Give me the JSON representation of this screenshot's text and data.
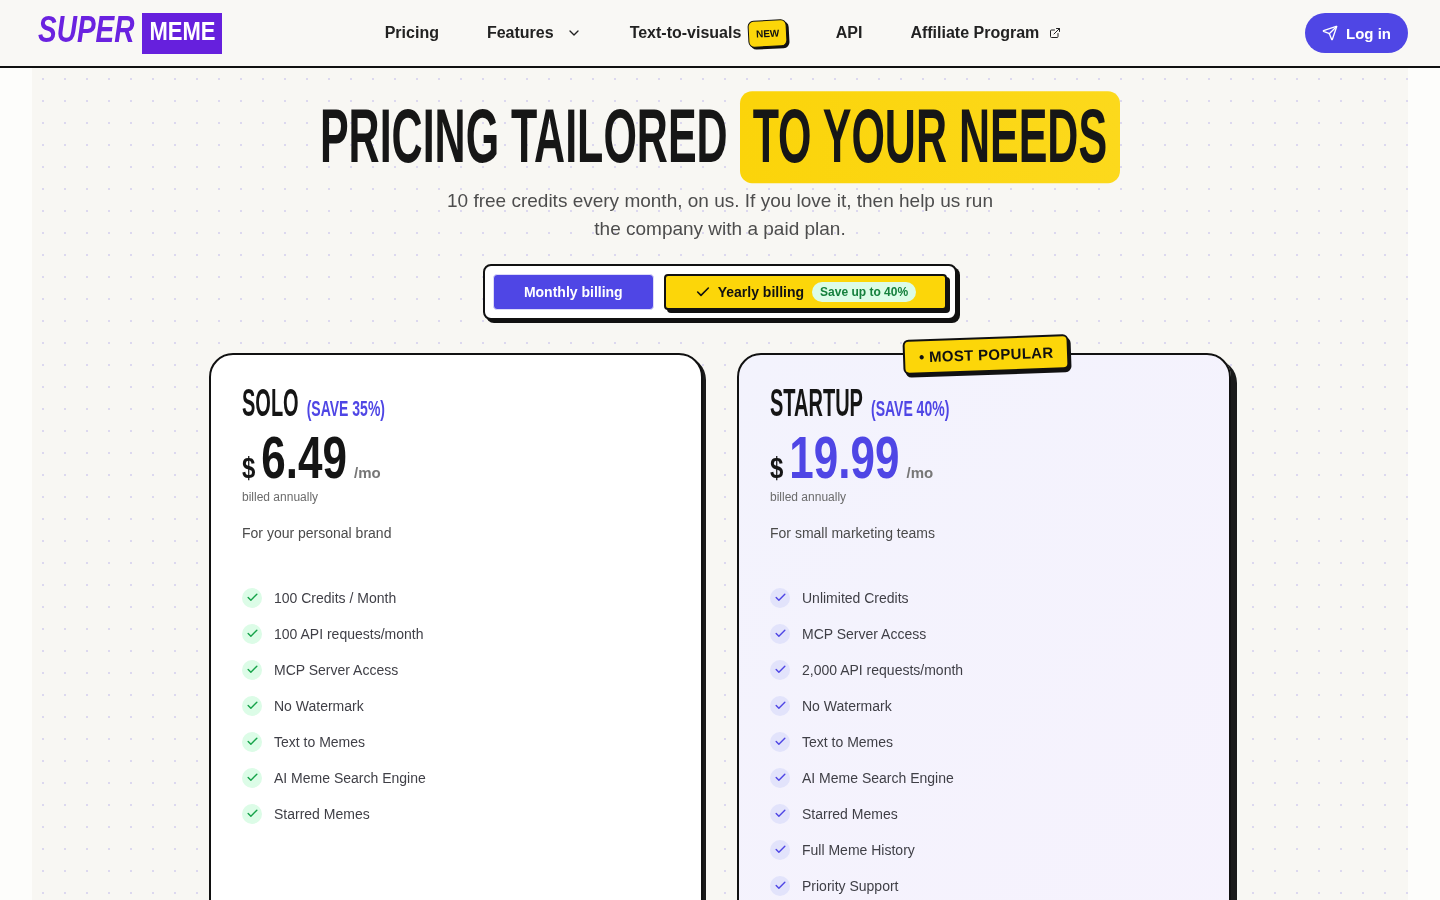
{
  "header": {
    "logo": {
      "text": "SUPER",
      "highlight": "MEME"
    },
    "nav": [
      {
        "label": "Pricing",
        "kind": "link"
      },
      {
        "label": "Features",
        "kind": "dropdown"
      },
      {
        "label": "Text-to-visuals",
        "kind": "link",
        "badge": "NEW"
      },
      {
        "label": "API",
        "kind": "link"
      },
      {
        "label": "Affiliate Program",
        "kind": "external"
      }
    ],
    "login_button": "Log in"
  },
  "hero": {
    "title": "PRICING TAILORED",
    "title_highlight": "TO YOUR NEEDS",
    "subtitle": "10 free credits every month, on us. If you love it, then help us run the company with a paid plan."
  },
  "billing_options": [
    {
      "label": "Monthly billing",
      "selected": false
    },
    {
      "label": "Yearly billing",
      "selected": true,
      "tag": "Save up to 40%"
    }
  ],
  "plans": [
    {
      "name": "SOLO",
      "saving": "(SAVE 35%)",
      "featured": false,
      "currency": "$",
      "price": "6.49",
      "period": "/mo",
      "billing_note": "billed annually",
      "description": "For your personal brand",
      "features": [
        "100 Credits / Month",
        "100 API requests/month",
        "MCP Server Access",
        "No Watermark",
        "Text to Memes",
        "AI Meme Search Engine",
        "Starred Memes"
      ]
    },
    {
      "name": "STARTUP",
      "saving": "(SAVE 40%)",
      "featured": true,
      "badge": "• MOST POPULAR",
      "currency": "$",
      "price": "19.99",
      "period": "/mo",
      "billing_note": "billed annually",
      "description": "For small marketing teams",
      "features": [
        "Unlimited Credits",
        "MCP Server Access",
        "2,000 API requests/month",
        "No Watermark",
        "Text to Memes",
        "AI Meme Search Engine",
        "Starred Memes",
        "Full Meme History",
        "Priority Support"
      ]
    }
  ]
}
